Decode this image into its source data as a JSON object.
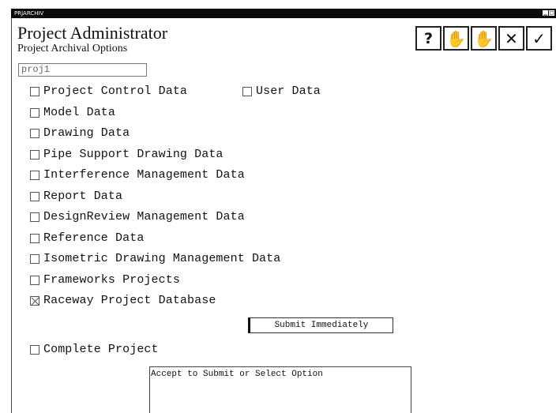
{
  "window": {
    "caption": "PRJARCHIV"
  },
  "header": {
    "title": "Project Administrator",
    "subtitle": "Project Archival Options"
  },
  "toolbar": {
    "buttons": [
      "help-icon",
      "hand-icon",
      "hand-icon",
      "cancel-icon",
      "accept-icon"
    ]
  },
  "project_field": {
    "value": "proj1"
  },
  "options": [
    {
      "label": "Project Control Data",
      "checked": false
    },
    {
      "label": "User Data",
      "checked": false
    },
    {
      "label": "Model Data",
      "checked": false
    },
    {
      "label": "Drawing Data",
      "checked": false
    },
    {
      "label": "Pipe Support Drawing Data",
      "checked": false
    },
    {
      "label": "Interference Management Data",
      "checked": false
    },
    {
      "label": "Report Data",
      "checked": false
    },
    {
      "label": "DesignReview Management Data",
      "checked": false
    },
    {
      "label": "Reference Data",
      "checked": false
    },
    {
      "label": "Isometric Drawing Management Data",
      "checked": false
    },
    {
      "label": "Frameworks Projects",
      "checked": false
    },
    {
      "label": "Raceway Project Database",
      "checked": true
    }
  ],
  "submit_button": {
    "label": "Submit Immediately"
  },
  "complete_project": {
    "label": "Complete Project",
    "checked": false
  },
  "message": {
    "text": "Accept to Submit or Select Option"
  }
}
